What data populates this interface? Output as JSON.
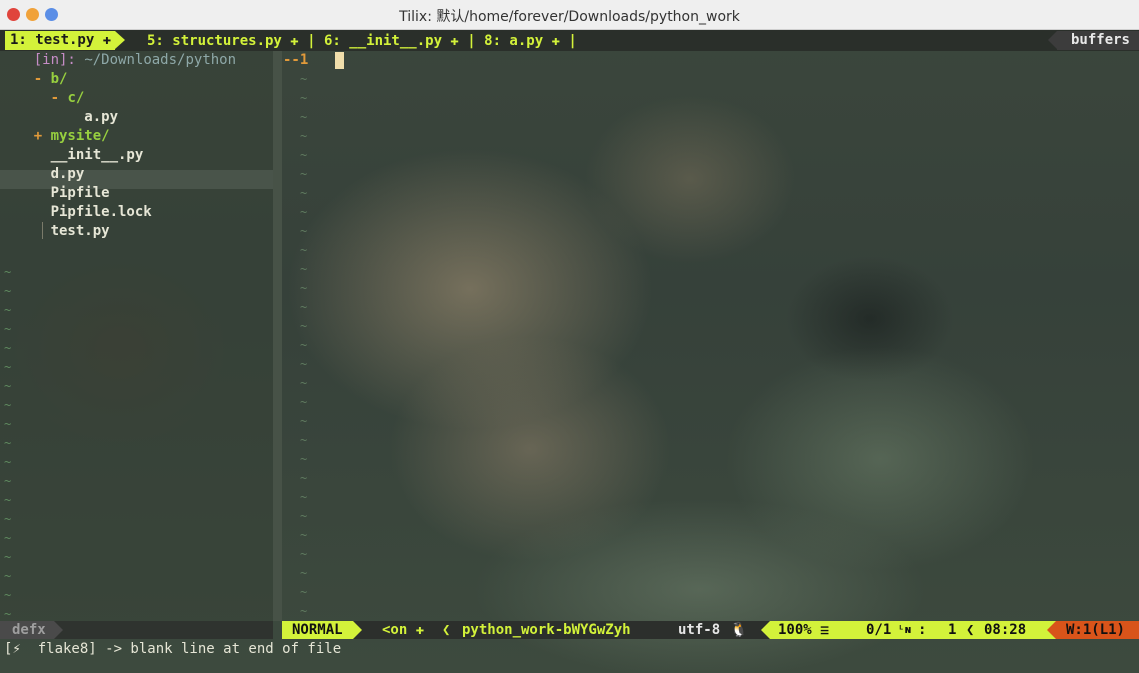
{
  "window": {
    "title": "Tilix: 默认/home/forever/Downloads/python_work"
  },
  "tabline": {
    "active_tab": "1: test.py ✚",
    "other_tabs": "5: structures.py ✚ | 6: __init__.py ✚ | 8: a.py ✚ |",
    "buffers_label": "buffers"
  },
  "tree": {
    "header_tag": "[in]:",
    "header_path": "~/Downloads/python",
    "items": [
      {
        "sign": "- ",
        "name": "b/",
        "indent": "    ",
        "kind": "dir"
      },
      {
        "sign": "- ",
        "name": "c/",
        "indent": "      ",
        "kind": "dir"
      },
      {
        "sign": "",
        "name": "a.py",
        "indent": "          ",
        "kind": "file"
      },
      {
        "sign": "+ ",
        "name": "mysite/",
        "indent": "    ",
        "kind": "dir"
      },
      {
        "sign": "",
        "name": "__init__.py",
        "indent": "      ",
        "kind": "file"
      },
      {
        "sign": "",
        "name": "d.py",
        "indent": "      ",
        "kind": "file"
      },
      {
        "sign": "",
        "name": "Pipfile",
        "indent": "      ",
        "kind": "file"
      },
      {
        "sign": "",
        "name": "Pipfile.lock",
        "indent": "      ",
        "kind": "file"
      },
      {
        "sign": "",
        "name": "test.py",
        "indent": "      ",
        "kind": "file"
      }
    ],
    "status_label": "defx"
  },
  "editor": {
    "line_number": "--1"
  },
  "statusline": {
    "mode": "NORMAL",
    "branch": "<on ✚ ",
    "venv": "python_work-bWYGwZyh",
    "encoding": "utf-8",
    "os_icon": "linux-icon",
    "percent": "100%",
    "position": "0/1",
    "column": "1",
    "time": "08:28",
    "warning": "W:1(L1)"
  },
  "message": "[⚡  flake8] -> blank line at end of file",
  "colors": {
    "accent": "#d3f23a",
    "warning": "#d9541a",
    "dir": "#97cf3f",
    "dir_sign": "#e09a3a"
  }
}
